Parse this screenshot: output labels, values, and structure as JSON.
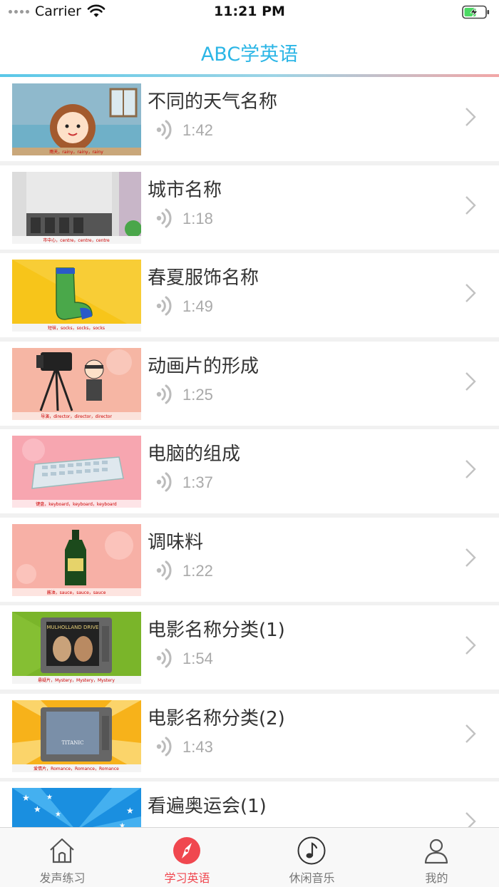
{
  "status_bar": {
    "carrier": "Carrier",
    "time": "11:21 PM"
  },
  "nav": {
    "title": "ABC学英语"
  },
  "items": [
    {
      "title": "不同的天气名称",
      "duration": "1:42",
      "caption": "雨天，rainy，rainy，rainy"
    },
    {
      "title": "城市名称",
      "duration": "1:18",
      "caption": "市中心，centre，centre，centre"
    },
    {
      "title": "春夏服饰名称",
      "duration": "1:49",
      "caption": "短袜，socks，socks，socks"
    },
    {
      "title": "动画片的形成",
      "duration": "1:25",
      "caption": "导演，director，director，director"
    },
    {
      "title": "电脑的组成",
      "duration": "1:37",
      "caption": "键盘，keyboard，keyboard，keyboard"
    },
    {
      "title": "调味料",
      "duration": "1:22",
      "caption": "酱油，sauce，sauce，sauce"
    },
    {
      "title": "电影名称分类(1)",
      "duration": "1:54",
      "caption": "悬疑片，Mystery，Mystery，Mystery",
      "poster_text": "MULHOLLAND DRIVE"
    },
    {
      "title": "电影名称分类(2)",
      "duration": "1:43",
      "caption": "爱情片，Romance，Romance，Romance",
      "poster_text": "TITANIC"
    },
    {
      "title": "看遍奥运会(1)",
      "duration": "",
      "caption": ""
    }
  ],
  "tabs": [
    {
      "label": "发声练习",
      "icon": "home-icon",
      "active": false
    },
    {
      "label": "学习英语",
      "icon": "compass-icon",
      "active": true
    },
    {
      "label": "休闲音乐",
      "icon": "music-note-icon",
      "active": false
    },
    {
      "label": "我的",
      "icon": "person-icon",
      "active": false
    }
  ],
  "colors": {
    "accent": "#2cb6e6",
    "active_tab": "#f0474f",
    "inactive_tab": "#777777",
    "duration_text": "#a9a9a9"
  }
}
